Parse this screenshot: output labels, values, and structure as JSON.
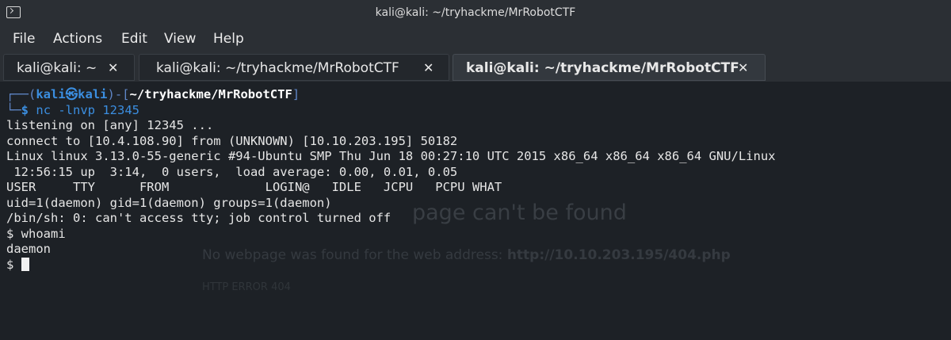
{
  "window": {
    "title": "kali@kali: ~/tryhackme/MrRobotCTF"
  },
  "menu": [
    "File",
    "Actions",
    "Edit",
    "View",
    "Help"
  ],
  "tabs": [
    {
      "label": "kali@kali: ~",
      "close": "✕"
    },
    {
      "label": "kali@kali: ~/tryhackme/MrRobotCTF",
      "close": "✕"
    },
    {
      "label": "kali@kali: ~/tryhackme/MrRobotCTF",
      "close": "✕"
    }
  ],
  "prompt": {
    "corner_top": "┌──(",
    "user": "kali",
    "at": "㉿",
    "host": "kali",
    "sep": ")-[",
    "dir": "~/tryhackme/MrRobotCTF",
    "close": "]",
    "corner_bottom": "└─",
    "dollar": "$",
    "command": "nc -lnvp 12345"
  },
  "output": [
    "listening on [any] 12345 ...",
    "connect to [10.4.108.90] from (UNKNOWN) [10.10.203.195] 50182",
    "Linux linux 3.13.0-55-generic #94-Ubuntu SMP Thu Jun 18 00:27:10 UTC 2015 x86_64 x86_64 x86_64 GNU/Linux",
    " 12:56:15 up  3:14,  0 users,  load average: 0.00, 0.01, 0.05",
    "USER     TTY      FROM             LOGIN@   IDLE   JCPU   PCPU WHAT",
    "uid=1(daemon) gid=1(daemon) groups=1(daemon)",
    "/bin/sh: 0: can't access tty; job control turned off",
    "$ whoami",
    "daemon",
    "$ "
  ],
  "background_ghost": {
    "heading": "page can't be found",
    "message_prefix": "No webpage was found for the web address:",
    "message_url": "http://10.10.203.195/404.php",
    "error": "HTTP ERROR 404"
  }
}
